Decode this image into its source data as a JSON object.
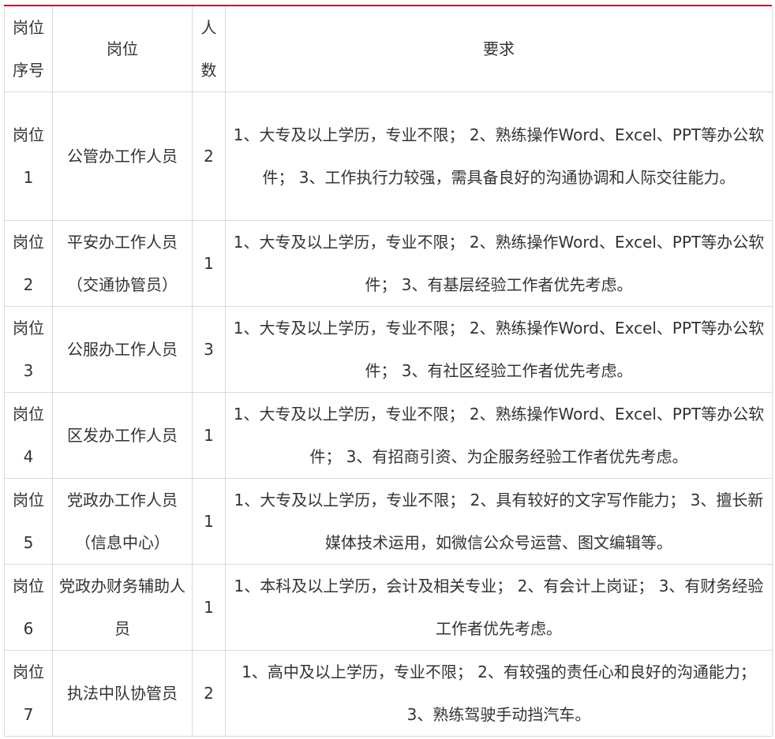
{
  "header": {
    "seq_label": "岗位序号",
    "position_label": "岗位",
    "count_label": "人数",
    "req_label": "要求"
  },
  "rows": [
    {
      "seq": "岗位1",
      "position": "公管办工作人员",
      "count": "2",
      "req": "1、大专及以上学历，专业不限； 2、熟练操作Word、Excel、PPT等办公软件； 3、工作执行力较强，需具备良好的沟通协调和人际交往能力。"
    },
    {
      "seq": "岗位2",
      "position": "平安办工作人员（交通协管员）",
      "count": "1",
      "req": "1、大专及以上学历，专业不限； 2、熟练操作Word、Excel、PPT等办公软件； 3、有基层经验工作者优先考虑。"
    },
    {
      "seq": "岗位3",
      "position": "公服办工作人员",
      "count": "3",
      "req": "1、大专及以上学历，专业不限； 2、熟练操作Word、Excel、PPT等办公软件； 3、有社区经验工作者优先考虑。"
    },
    {
      "seq": "岗位4",
      "position": "区发办工作人员",
      "count": "1",
      "req": "1、大专及以上学历，专业不限； 2、熟练操作Word、Excel、PPT等办公软件； 3、有招商引资、为企服务经验工作者优先考虑。"
    },
    {
      "seq": "岗位5",
      "position": "党政办工作人员（信息中心）",
      "count": "1",
      "req": "1、大专及以上学历，专业不限； 2、具有较好的文字写作能力； 3、擅长新媒体技术运用，如微信公众号运营、图文编辑等。"
    },
    {
      "seq": "岗位6",
      "position": "党政办财务辅助人员",
      "count": "1",
      "req": "1、本科及以上学历，会计及相关专业； 2、有会计上岗证； 3、有财务经验工作者优先考虑。"
    },
    {
      "seq": "岗位7",
      "position": "执法中队协管员",
      "count": "2",
      "req": "1、高中及以上学历，专业不限； 2、有较强的责任心和良好的沟通能力； 3、熟练驾驶手动挡汽车。"
    }
  ],
  "colors": {
    "accent_rule": "#c8102e",
    "grid": "#d9d9d9",
    "text": "#333333"
  }
}
